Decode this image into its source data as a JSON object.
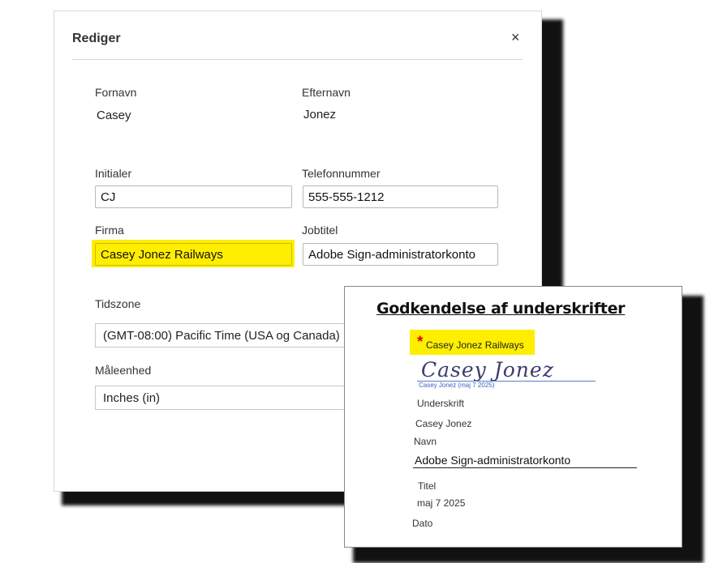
{
  "dialog": {
    "title": "Rediger",
    "close_symbol": "×",
    "first_name_label": "Fornavn",
    "first_name_value": "Casey",
    "last_name_label": "Efternavn",
    "last_name_value": "Jonez",
    "initials_label": "Initialer",
    "initials_value": "CJ",
    "phone_label": "Telefonnummer",
    "phone_value": "555-555-1212",
    "company_label": "Firma",
    "company_value": "Casey Jonez Railways",
    "jobtitle_label": "Jobtitel",
    "jobtitle_value": "Adobe Sign-administratorkonto",
    "timezone_label": "Tidszone",
    "timezone_value": "(GMT-08:00) Pacific Time (USA og Canada)",
    "unit_label": "Måleenhed",
    "unit_value": "Inches (in)"
  },
  "document": {
    "heading": "Godkendelse af underskrifter",
    "required_star": "*",
    "company": "Casey Jonez Railways",
    "signature_script": "Casey Jonez",
    "signature_caption": "Casey Jonez (maj 7 2025)",
    "signature_label": "Underskrift",
    "name_value": "Casey Jonez",
    "name_label": "Navn",
    "title_value": "Adobe Sign-administratorkonto",
    "title_label": "Titel",
    "date_value": "maj 7 2025",
    "date_label": "Dato"
  },
  "colors": {
    "highlight": "#ffee00",
    "required": "#e00000",
    "signature_ink": "#3c3c70"
  }
}
